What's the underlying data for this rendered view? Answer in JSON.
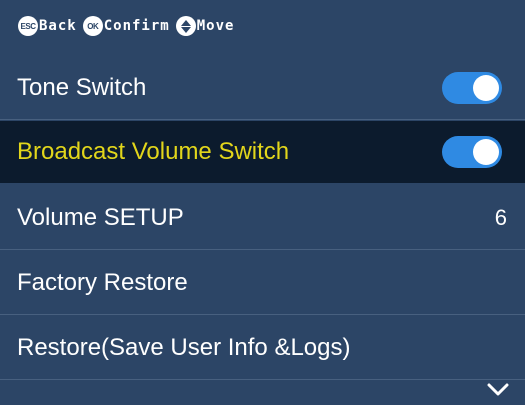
{
  "hints": [
    {
      "key": "ESC",
      "label": "Back"
    },
    {
      "key": "OK",
      "label": "Confirm"
    },
    {
      "key": "",
      "label": "Move"
    }
  ],
  "menu": {
    "items": [
      {
        "label": "Tone Switch",
        "toggle_on": true
      },
      {
        "label": "Broadcast Volume Switch",
        "toggle_on": true
      },
      {
        "label": "Volume SETUP",
        "value": "6"
      },
      {
        "label": "Factory Restore"
      },
      {
        "label": "Restore(Save User Info &Logs)"
      }
    ],
    "selected_index": 1
  },
  "icons": {
    "move": "up-down-arrows-icon",
    "more": "chevron-down-icon"
  },
  "colors": {
    "background": "#2c4566",
    "selected_background": "#0c1b2d",
    "selected_text": "#e2d61b",
    "toggle_on": "#2f8ae3",
    "divider": "#48607f"
  }
}
